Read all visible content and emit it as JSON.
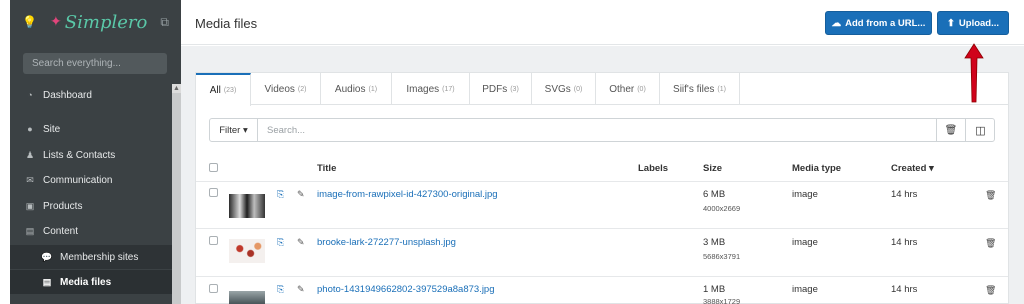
{
  "sidebar": {
    "logo": "Simplero",
    "search_placeholder": "Search everything...",
    "items": [
      {
        "label": "Dashboard",
        "icon": "tachometer-icon"
      },
      {
        "label": "Site",
        "icon": "globe-icon"
      },
      {
        "label": "Lists & Contacts",
        "icon": "person-icon"
      },
      {
        "label": "Communication",
        "icon": "envelope-icon"
      },
      {
        "label": "Products",
        "icon": "box-icon"
      },
      {
        "label": "Content",
        "icon": "film-icon"
      },
      {
        "label": "Membership sites",
        "icon": "chat-icon"
      },
      {
        "label": "Media files",
        "icon": "film-icon"
      }
    ]
  },
  "header": {
    "title": "Media files",
    "add_url_label": "Add from a URL...",
    "upload_label": "Upload..."
  },
  "tabs": [
    {
      "label": "All",
      "count": "(23)"
    },
    {
      "label": "Videos",
      "count": "(2)"
    },
    {
      "label": "Audios",
      "count": "(1)"
    },
    {
      "label": "Images",
      "count": "(17)"
    },
    {
      "label": "PDFs",
      "count": "(3)"
    },
    {
      "label": "SVGs",
      "count": "(0)"
    },
    {
      "label": "Other",
      "count": "(0)"
    },
    {
      "label": "Siif's files",
      "count": "(1)"
    }
  ],
  "filter": {
    "filter_label": "Filter ▾",
    "search_placeholder": "Search..."
  },
  "table": {
    "columns": [
      "Title",
      "Labels",
      "Size",
      "Media type",
      "Created ▾"
    ],
    "rows": [
      {
        "title": "image-from-rawpixel-id-427300-original.jpg",
        "size": "6 MB",
        "dims": "4000x2669",
        "type": "image",
        "created": "14 hrs"
      },
      {
        "title": "brooke-lark-272277-unsplash.jpg",
        "size": "3 MB",
        "dims": "5686x3791",
        "type": "image",
        "created": "14 hrs"
      },
      {
        "title": "photo-1431949662802-397529a8a873.jpg",
        "size": "1 MB",
        "dims": "3888x1729",
        "type": "image",
        "created": "14 hrs"
      }
    ]
  },
  "colors": {
    "accent": "#1a6fb8",
    "sidebar_bg": "#3b4144",
    "annotation": "#d0021b"
  }
}
